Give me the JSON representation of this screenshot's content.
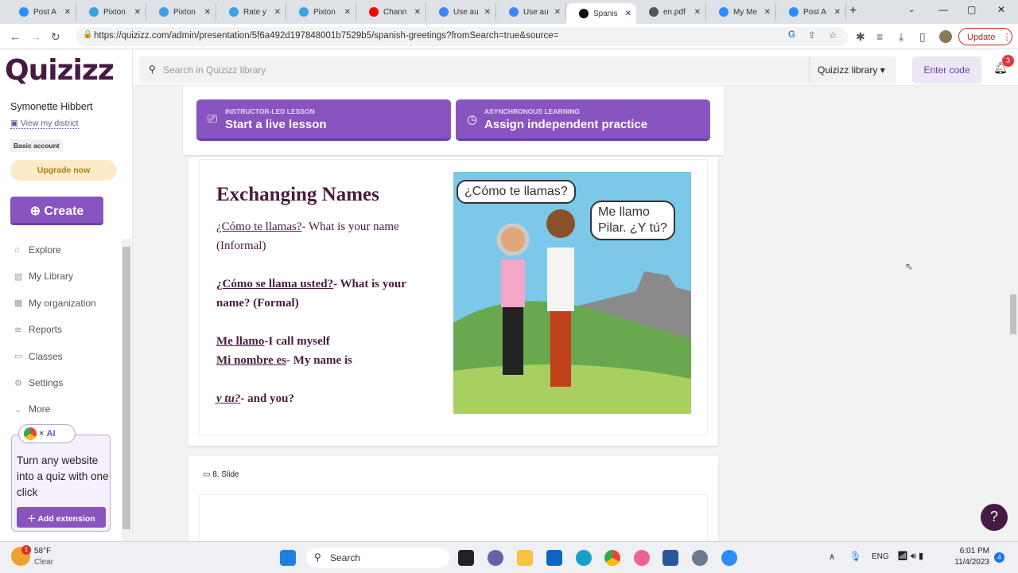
{
  "browser": {
    "tabs": [
      {
        "title": "Post A",
        "color": "#2d8cff"
      },
      {
        "title": "Pixton",
        "color": "#3aa0e8"
      },
      {
        "title": "Pixton",
        "color": "#3aa0e8"
      },
      {
        "title": "Rate y",
        "color": "#3aa0e8"
      },
      {
        "title": "Pixton",
        "color": "#3aa0e8"
      },
      {
        "title": "Chann",
        "color": "#ff0000"
      },
      {
        "title": "Use au",
        "color": "#4285f4"
      },
      {
        "title": "Use au",
        "color": "#4285f4"
      },
      {
        "title": "Spanis",
        "color": "#111111"
      },
      {
        "title": "en.pdf",
        "color": "#555555"
      },
      {
        "title": "My Me",
        "color": "#2d8cff"
      },
      {
        "title": "Post A",
        "color": "#2d8cff"
      }
    ],
    "active_tab": 8,
    "url": "https://quizizz.com/admin/presentation/5f6a492d197848001b7529b5/spanish-greetings?fromSearch=true&source=",
    "update_label": "Update"
  },
  "sidebar": {
    "logo": "Quizizz",
    "user": "Symonette Hibbert",
    "district_link": "View my district",
    "account": "Basic account",
    "upgrade": "Upgrade now",
    "create": "Create",
    "items": [
      {
        "label": "Explore",
        "icon": "explore-icon"
      },
      {
        "label": "My Library",
        "icon": "library-icon"
      },
      {
        "label": "My organization",
        "icon": "organization-icon"
      },
      {
        "label": "Reports",
        "icon": "reports-icon"
      },
      {
        "label": "Classes",
        "icon": "classes-icon"
      },
      {
        "label": "Settings",
        "icon": "settings-icon"
      },
      {
        "label": "More",
        "icon": "chevron-down-icon"
      }
    ],
    "promo": {
      "text": "Turn any website into a quiz with one click",
      "button": "Add extension"
    }
  },
  "header": {
    "search_placeholder": "Search in Quizizz library",
    "library_select": "Quizizz library",
    "enter_code": "Enter code",
    "notifications": "3"
  },
  "actions": {
    "live": {
      "kicker": "INSTRUCTOR-LED LESSON",
      "label": "Start a live lesson"
    },
    "async": {
      "kicker": "ASYNCHRONOUS LEARNING",
      "label": "Assign independent practice"
    }
  },
  "slide": {
    "title": "Exchanging Names",
    "l1a": "¿Cómo te llamas?",
    "l1b": "- What is your name",
    "l1c": "(Informal)",
    "l2a": "¿Cómo se llama usted?",
    "l2b": "- What is your",
    "l2c": "name? (Formal)",
    "l3a": "Me llamo",
    "l3b": "-I call myself",
    "l4a": "Mi nombre es",
    "l4b": "- My name is",
    "l5a": "y tu?",
    "l5b": "- and you?",
    "bubble1": "¿Cómo te llamas?",
    "bubble2a": "Me llamo",
    "bubble2b": "Pilar. ¿Y tú?"
  },
  "next_slide": {
    "label": "8. Slide"
  },
  "help": "?",
  "taskbar": {
    "weather_temp": "58°F",
    "weather_desc": "Clear",
    "weather_badge": "1",
    "search": "Search",
    "lang": "ENG",
    "time": "6:01 PM",
    "date": "11/4/2023",
    "notif": "4"
  }
}
